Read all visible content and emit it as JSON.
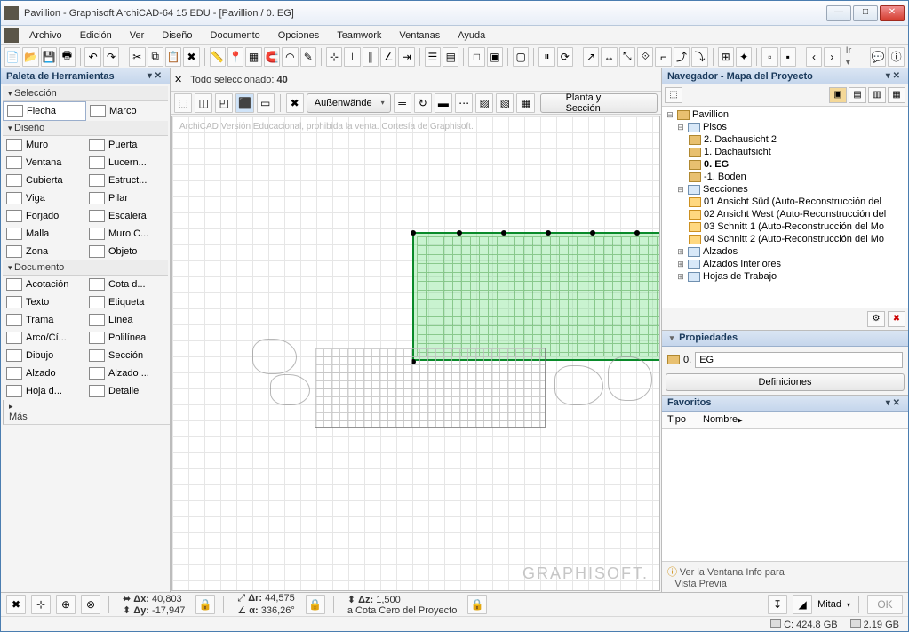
{
  "window": {
    "title": "Pavillion - Graphisoft ArchiCAD-64 15 EDU - [Pavillion / 0. EG]"
  },
  "menu": [
    "Archivo",
    "Edición",
    "Ver",
    "Diseño",
    "Documento",
    "Opciones",
    "Teamwork",
    "Ventanas",
    "Ayuda"
  ],
  "toolbox": {
    "title": "Paleta de Herramientas",
    "sections": {
      "seleccion": "Selección",
      "diseno": "Diseño",
      "documento": "Documento",
      "mas": "Más"
    },
    "tools": {
      "flecha": "Flecha",
      "marco": "Marco",
      "muro": "Muro",
      "puerta": "Puerta",
      "ventana": "Ventana",
      "lucern": "Lucern...",
      "cubierta": "Cubierta",
      "estruct": "Estruct...",
      "viga": "Viga",
      "pilar": "Pilar",
      "forjado": "Forjado",
      "escalera": "Escalera",
      "malla": "Malla",
      "muroc": "Muro C...",
      "zona": "Zona",
      "objeto": "Objeto",
      "acotacion": "Acotación",
      "cotad": "Cota d...",
      "texto": "Texto",
      "etiqueta": "Etiqueta",
      "trama": "Trama",
      "linea": "Línea",
      "arco": "Arco/Cí...",
      "polilinea": "Polilínea",
      "dibujo": "Dibujo",
      "seccion": "Sección",
      "alzado": "Alzado",
      "alzado2": "Alzado ...",
      "hoja": "Hoja d...",
      "detalle": "Detalle"
    }
  },
  "canvas": {
    "selection_label": "Todo seleccionado:",
    "selection_count": "40",
    "layer_dropdown": "Außenwände",
    "view_button": "Planta y Sección",
    "watermark": "ArchiCAD Versión Educacional, prohibida la venta. Cortesía de Graphisoft.",
    "brand": "GRAPHISOFT."
  },
  "navigator": {
    "title": "Navegador - Mapa del Proyecto",
    "root": "Pavillion",
    "pisos_label": "Pisos",
    "pisos": [
      "2. Dachausicht 2",
      "1. Dachaufsicht",
      "0. EG",
      "-1. Boden"
    ],
    "secciones_label": "Secciones",
    "secciones": [
      "01 Ansicht Süd (Auto-Reconstrucción del",
      "02 Ansicht West  (Auto-Reconstrucción del",
      "03 Schnitt 1 (Auto-Reconstrucción del Mo",
      "04 Schnitt 2 (Auto-Reconstrucción del Mo"
    ],
    "alzados": "Alzados",
    "alzados_int": "Alzados Interiores",
    "hojas": "Hojas de Trabajo"
  },
  "properties": {
    "title": "Propiedades",
    "id": "0.",
    "name": "EG",
    "defs_btn": "Definiciones"
  },
  "favorites": {
    "title": "Favoritos",
    "col_tipo": "Tipo",
    "col_nombre": "Nombre",
    "footer1": "Ver la Ventana Info para",
    "footer2": "Vista Previa"
  },
  "status": {
    "dx_label": "Δx:",
    "dx": "40,803",
    "dy_label": "Δy:",
    "dy": "-17,947",
    "dr_label": "Δr:",
    "dr": "44,575",
    "da_label": "α:",
    "da": "336,26°",
    "dz_label": "Δz:",
    "dz": "1,500",
    "cota": "a Cota Cero del Proyecto",
    "scale": "Mitad",
    "ok": "OK",
    "disk_c": "C: 424.8 GB",
    "disk2": "2.19 GB"
  }
}
